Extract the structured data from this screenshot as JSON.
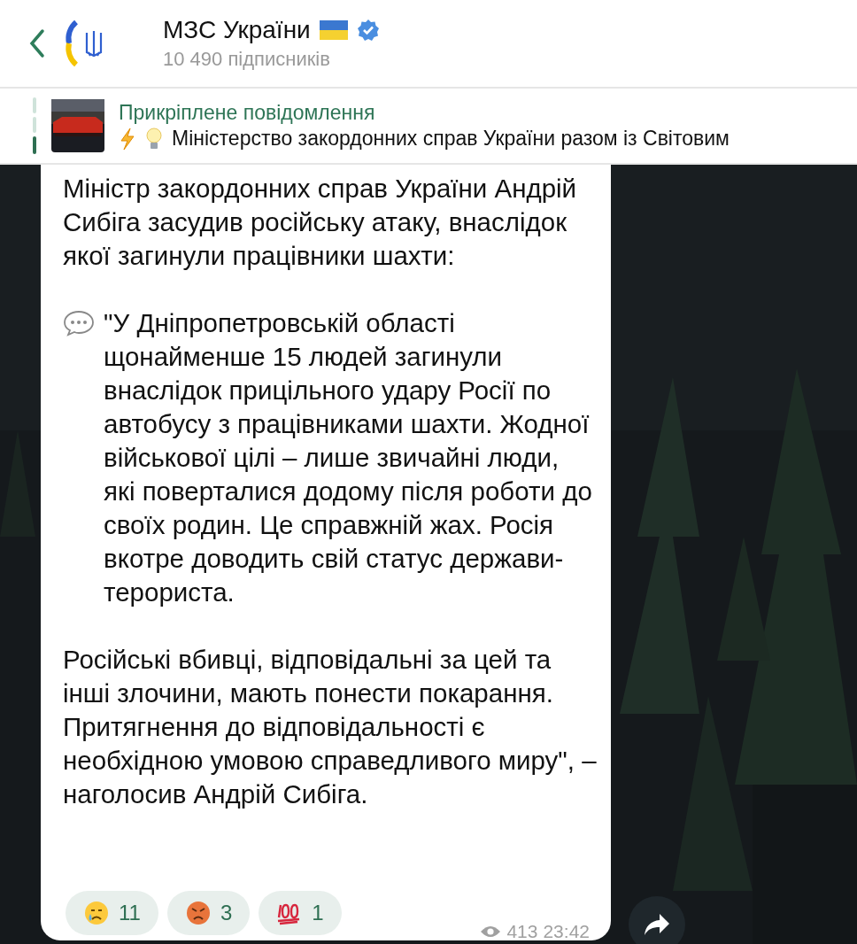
{
  "header": {
    "channel_name": "МЗС України",
    "verified": true,
    "subscribers": "10 490 підписників"
  },
  "pinned": {
    "title": "Прикріплене повідомлення",
    "text": "Міністерство закордонних справ України разом із Світовим"
  },
  "message": {
    "paragraphs": [
      {
        "kind": "plain",
        "text": "Міністр закордонних справ України Андрій Сибіга засудив російську атаку, внаслідок якої загинули працівники шахти:"
      },
      {
        "kind": "quote",
        "text": "\"У Дніпропетровській області щонайменше 15 людей загинули внаслідок прицільного удару Росії по автобусу з працівниками шахти. Жодної військової цілі – лише звичайні люди, які поверталися додому після роботи до своїх родин. Це справжній жах. Росія вкотре доводить свій статус держави-терориста."
      },
      {
        "kind": "plain",
        "text": "Російські вбивці, відповідальні за цей та інші злочини, мають понести покарання. Притягнення до відповідальності є необхідною умовою справедливого миру\", – наголосив Андрій Сибіга."
      }
    ],
    "reactions": [
      {
        "kind": "crying",
        "count": "11"
      },
      {
        "kind": "angry",
        "count": "3"
      },
      {
        "kind": "hundred",
        "count": "1"
      }
    ],
    "views": "413",
    "time": "23:42"
  }
}
